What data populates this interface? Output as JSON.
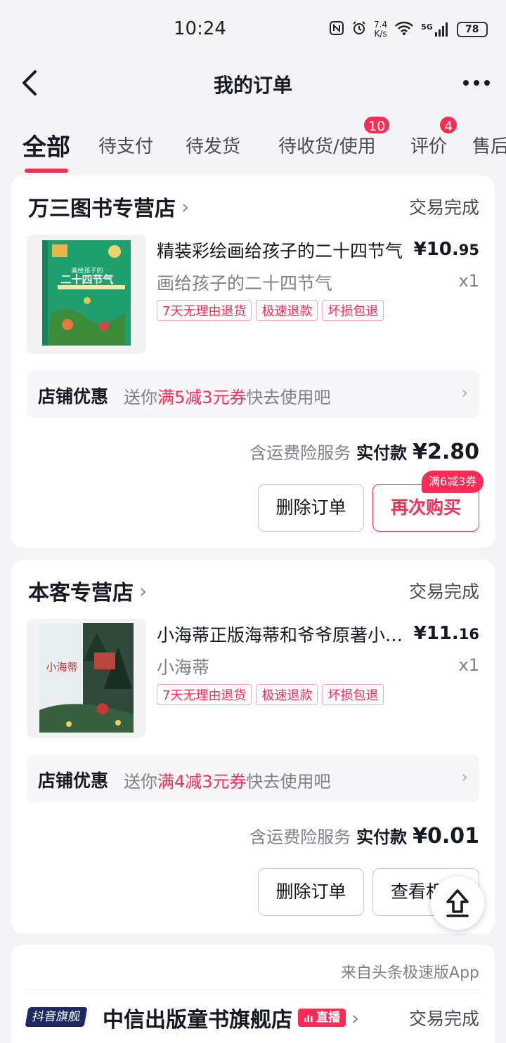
{
  "status_bar": {
    "time": "10:24",
    "net_speed": "7.4",
    "net_unit": "K/s",
    "network": "5G",
    "battery": "78"
  },
  "header": {
    "title": "我的订单"
  },
  "tabs": [
    {
      "label": "全部",
      "active": true
    },
    {
      "label": "待支付"
    },
    {
      "label": "待发货"
    },
    {
      "label": "待收货/使用",
      "badge": "10"
    },
    {
      "label": "评价",
      "badge": "4"
    },
    {
      "label": "售后"
    }
  ],
  "orders": [
    {
      "shop": "万三图书专营店",
      "status": "交易完成",
      "title": "精装彩绘画给孩子的二十四节气",
      "price_main": "¥10.",
      "price_cents": "95",
      "spec": "画给孩子的二十四节气",
      "qty": "x1",
      "tags": [
        "7天无理由退货",
        "极速退款",
        "坏损包退"
      ],
      "promo_label": "店铺优惠",
      "promo_prefix": "送你",
      "promo_highlight": "满5减3元券",
      "promo_suffix": "快去使用吧",
      "pay_note": "含运费险服务",
      "pay_label": "实付款",
      "pay_amount": "¥2.80",
      "btn_left": "删除订单",
      "btn_right": "再次购买",
      "btn_badge": "满6减3券",
      "cover_title_top": "画给孩子的",
      "cover_title_main": "二十四节气"
    },
    {
      "shop": "本客专营店",
      "status": "交易完成",
      "title": "小海蒂正版海蒂和爷爷原著小学生",
      "price_main": "¥11.",
      "price_cents": "16",
      "spec": "小海蒂",
      "qty": "x1",
      "tags": [
        "7天无理由退货",
        "极速退款",
        "坏损包退"
      ],
      "promo_label": "店铺优惠",
      "promo_prefix": "送你",
      "promo_highlight": "满4减3元券",
      "promo_suffix": "快去使用吧",
      "pay_note": "含运费险服务",
      "pay_label": "实付款",
      "pay_amount": "¥0.01",
      "btn_left": "删除订单",
      "btn_right": "查看相似",
      "cover_title": "小海蒂"
    },
    {
      "source": "来自头条极速版App",
      "flagship_label": "抖音旗舰",
      "shop": "中信出版童书旗舰店",
      "live_label": "直播",
      "status": "交易完成"
    }
  ],
  "colors": {
    "accent": "#fe2c55",
    "text": "#161823",
    "muted": "#80808a"
  }
}
